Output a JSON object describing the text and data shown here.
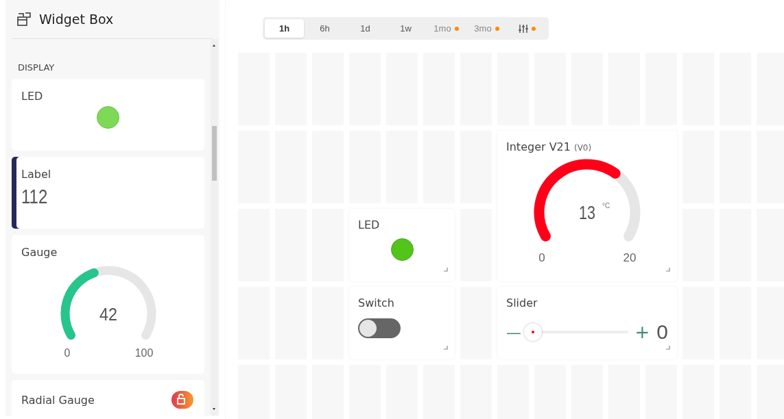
{
  "sidebar": {
    "title": "Widget Box",
    "section": "DISPLAY",
    "widgets": [
      {
        "kind": "led",
        "label": "LED",
        "color": "#7ed957",
        "selected": false,
        "locked": false
      },
      {
        "kind": "label",
        "label": "Label",
        "value": "112",
        "selected": true,
        "locked": false
      },
      {
        "kind": "gauge",
        "label": "Gauge",
        "value": "42",
        "min": "0",
        "max": "100",
        "color": "#26c58c",
        "selected": false,
        "locked": false
      },
      {
        "kind": "radial",
        "label": "Radial Gauge",
        "selected": false,
        "locked": true
      }
    ]
  },
  "time_range": {
    "tabs": [
      {
        "kind": "text",
        "label": "1h",
        "selected": true,
        "premium": false
      },
      {
        "kind": "text",
        "label": "6h",
        "selected": false,
        "premium": false
      },
      {
        "kind": "text",
        "label": "1d",
        "selected": false,
        "premium": false
      },
      {
        "kind": "text",
        "label": "1w",
        "selected": false,
        "premium": false
      },
      {
        "kind": "text",
        "label": "1mo",
        "selected": false,
        "premium": true
      },
      {
        "kind": "text",
        "label": "3mo",
        "selected": false,
        "premium": true
      },
      {
        "kind": "icon",
        "selected": false,
        "premium": true
      }
    ]
  },
  "dashboard": {
    "widgets": [
      {
        "kind": "gauge",
        "title": "Integer V21",
        "pin": "(V0)",
        "value": "13",
        "unit": "°C",
        "min": "0",
        "max": "20",
        "color": "#ff0019"
      },
      {
        "kind": "led",
        "title": "LED",
        "color": "#52c41a"
      },
      {
        "kind": "switch",
        "title": "Switch",
        "on": false
      },
      {
        "kind": "slider",
        "title": "Slider",
        "minus": "—",
        "plus": "+",
        "value": "0"
      }
    ]
  }
}
